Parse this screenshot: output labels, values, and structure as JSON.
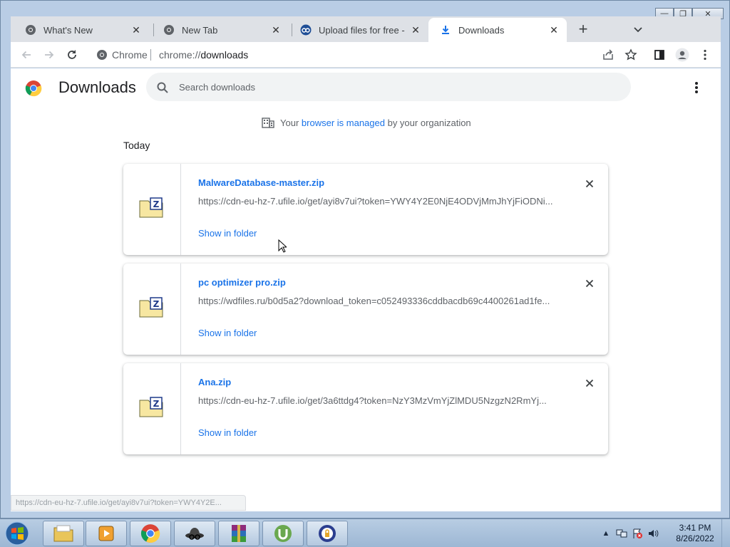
{
  "tabs": [
    {
      "label": "What's New",
      "close": "✕"
    },
    {
      "label": "New Tab",
      "close": "✕"
    },
    {
      "label": "Upload files for free - M",
      "close": "✕"
    },
    {
      "label": "Downloads",
      "close": "✕"
    }
  ],
  "new_tab_label": "+",
  "omnibox": {
    "site_label": "Chrome",
    "url_scheme": "chrome://",
    "url_path": "downloads"
  },
  "page": {
    "title": "Downloads",
    "search_placeholder": "Search downloads",
    "managed_prefix": "Your ",
    "managed_link": "browser is managed",
    "managed_suffix": " by your organization",
    "section_date": "Today"
  },
  "downloads": [
    {
      "name": "MalwareDatabase-master.zip",
      "url": "https://cdn-eu-hz-7.ufile.io/get/ayi8v7ui?token=YWY4Y2E0NjE4ODVjMmJhYjFiODNi...",
      "action": "Show in folder"
    },
    {
      "name": "pc optimizer pro.zip",
      "url": "https://wdfiles.ru/b0d5a2?download_token=c052493336cddbacdb69c4400261ad1fe...",
      "action": "Show in folder"
    },
    {
      "name": "Ana.zip",
      "url": "https://cdn-eu-hz-7.ufile.io/get/3a6ttdg4?token=NzY3MzVmYjZlMDU5NzgzN2RmYj...",
      "action": "Show in folder"
    }
  ],
  "status_bubble": "https://cdn-eu-hz-7.ufile.io/get/ayi8v7ui?token=YWY4Y2E...",
  "taskbar": {
    "time": "3:41 PM",
    "date": "8/26/2022"
  },
  "colors": {
    "accent": "#1a73e8",
    "tabstrip": "#dee1e6",
    "taskbar": "#b8cde3"
  },
  "icons": [
    "chrome-icon",
    "download-icon",
    "ufile-icon",
    "zip-icon",
    "search-icon",
    "building-icon",
    "close-icon",
    "share-icon",
    "star-icon",
    "sidepanel-icon",
    "profile-icon",
    "kebab-icon"
  ]
}
